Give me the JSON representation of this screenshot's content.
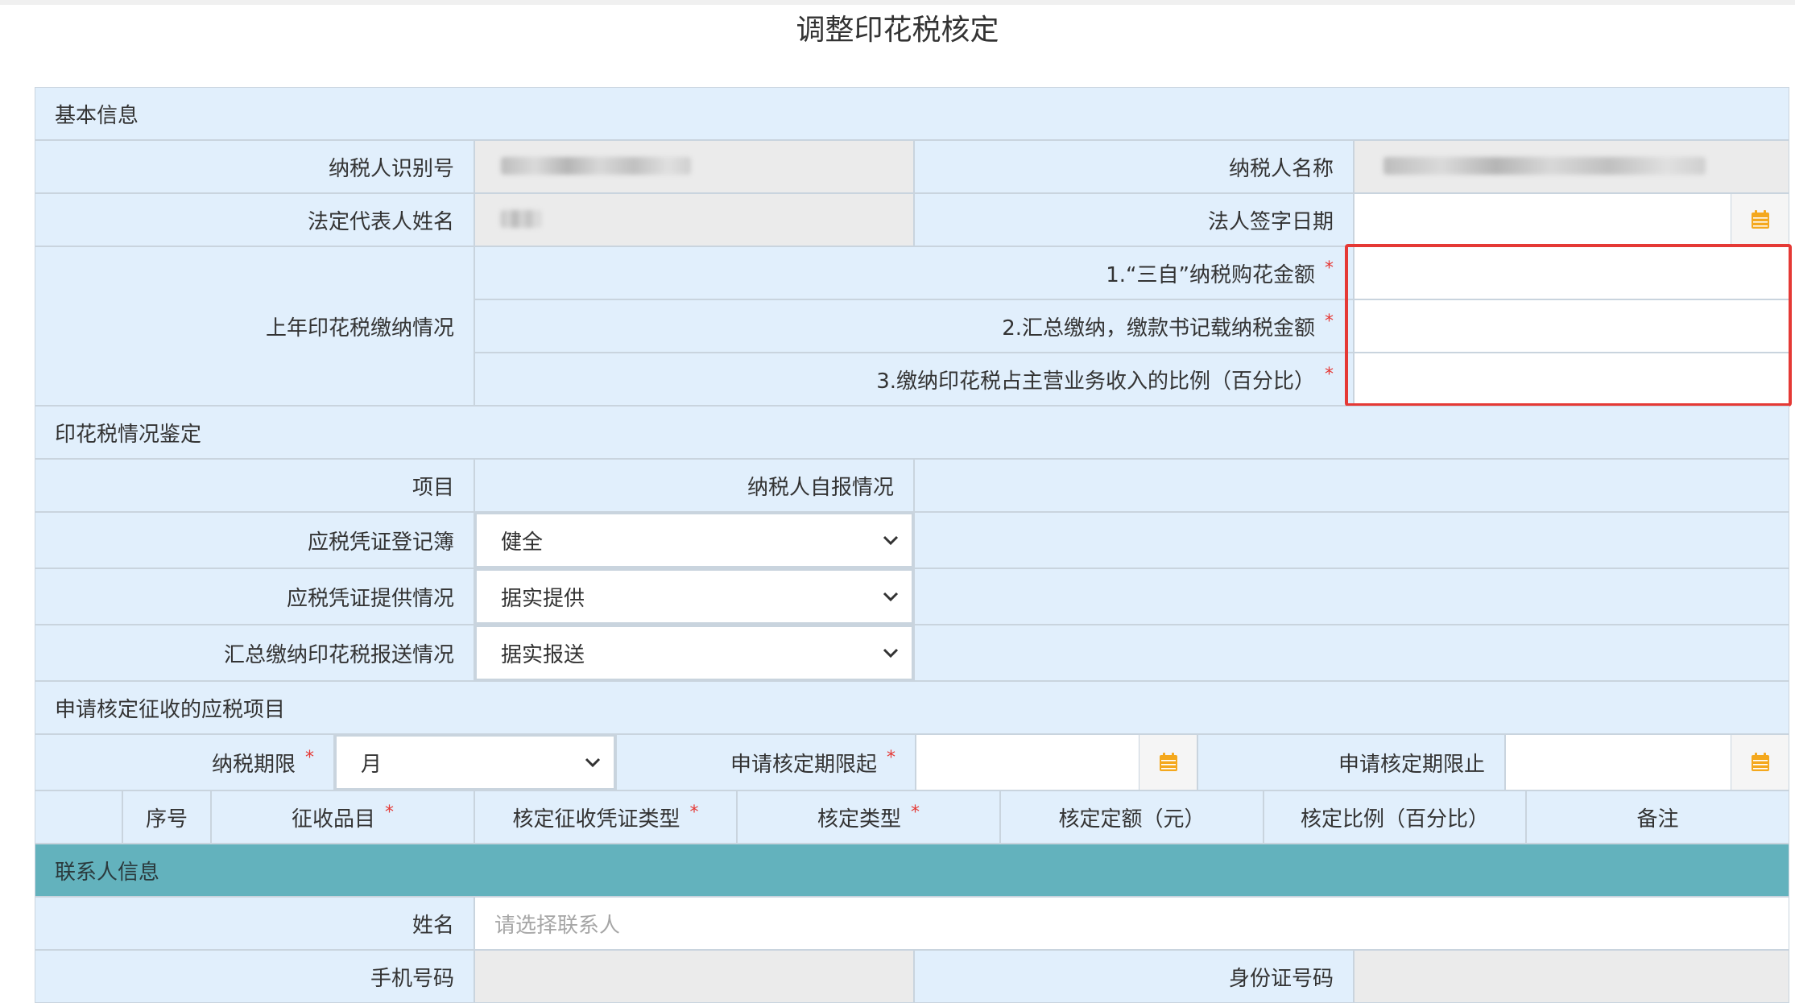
{
  "page": {
    "title": "调整印花税核定"
  },
  "basic_info": {
    "section_title": "基本信息",
    "taxpayer_id_label": "纳税人识别号",
    "taxpayer_name_label": "纳税人名称",
    "legal_rep_label": "法定代表人姓名",
    "sign_date_label": "法人签字日期"
  },
  "last_year": {
    "label": "上年印花税缴纳情况",
    "items": [
      {
        "label": "1.“三自”纳税购花金额",
        "required_mark": "*"
      },
      {
        "label": "2.汇总缴纳，缴款书记载纳税金额",
        "required_mark": "*"
      },
      {
        "label": "3.缴纳印花税占主营业务收入的比例（百分比）",
        "required_mark": "*"
      }
    ]
  },
  "assessment": {
    "section_title": "印花税情况鉴定",
    "col_item": "项目",
    "col_self_report": "纳税人自报情况",
    "rows": [
      {
        "label": "应税凭证登记簿",
        "value": "健全"
      },
      {
        "label": "应税凭证提供情况",
        "value": "据实提供"
      },
      {
        "label": "汇总缴纳印花税报送情况",
        "value": "据实报送"
      }
    ]
  },
  "apply": {
    "section_title": "申请核定征收的应税项目",
    "period_label": "纳税期限",
    "period_value": "月",
    "start_label": "申请核定期限起",
    "end_label": "申请核定期限止",
    "required_mark": "*",
    "table_headers": [
      {
        "label": "序号",
        "required": false
      },
      {
        "label": "征收品目",
        "required": true
      },
      {
        "label": "核定征收凭证类型",
        "required": true
      },
      {
        "label": "核定类型",
        "required": true
      },
      {
        "label": "核定定额（元）",
        "required": false
      },
      {
        "label": "核定比例（百分比）",
        "required": false
      },
      {
        "label": "备注",
        "required": false
      }
    ]
  },
  "contact": {
    "section_title": "联系人信息",
    "name_label": "姓名",
    "name_placeholder": "请选择联系人",
    "phone_label": "手机号码",
    "id_label": "身份证号码"
  },
  "colors": {
    "cell_bg": "#e1effc",
    "border": "#c9d4de",
    "teal_section": "#63b2bd",
    "required_red": "#e53935",
    "calendar_orange": "#f4a81d"
  },
  "icons": [
    "calendar-icon",
    "chevron-down-icon"
  ]
}
